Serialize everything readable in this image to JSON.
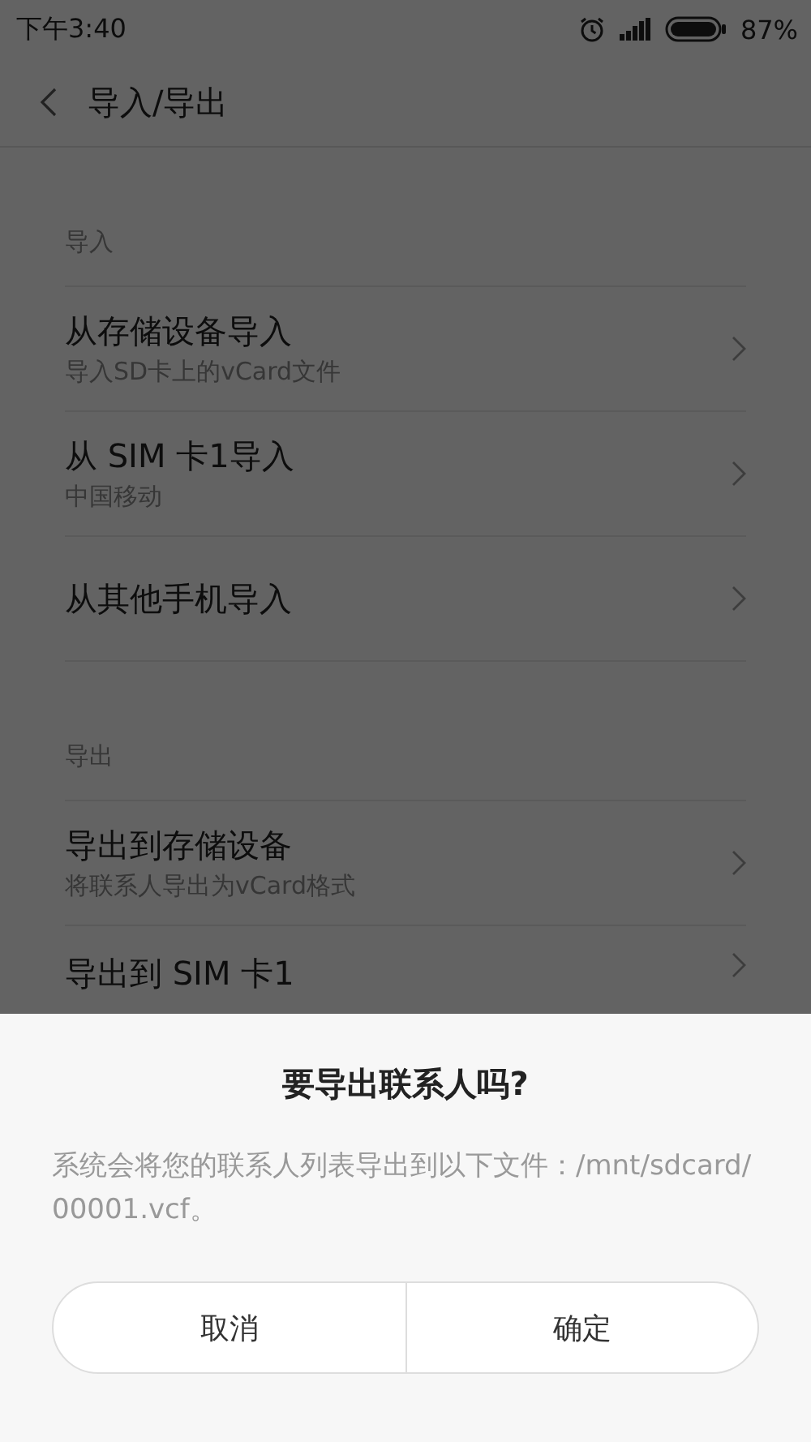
{
  "status_bar": {
    "time": "下午3:40",
    "battery": "87%"
  },
  "header": {
    "title": "导入/导出"
  },
  "sections": [
    {
      "title": "导入",
      "items": [
        {
          "title": "从存储设备导入",
          "subtitle": "导入SD卡上的vCard文件"
        },
        {
          "title": "从 SIM 卡1导入",
          "subtitle": "中国移动"
        },
        {
          "title": "从其他手机导入"
        }
      ]
    },
    {
      "title": "导出",
      "items": [
        {
          "title": "导出到存储设备",
          "subtitle": "将联系人导出为vCard格式"
        },
        {
          "title": "导出到 SIM 卡1"
        }
      ]
    }
  ],
  "dialog": {
    "title": "要导出联系人吗?",
    "message": "系统会将您的联系人列表导出到以下文件：/mnt/sdcard/00001.vcf。",
    "buttons": [
      "取消",
      "确定"
    ]
  }
}
